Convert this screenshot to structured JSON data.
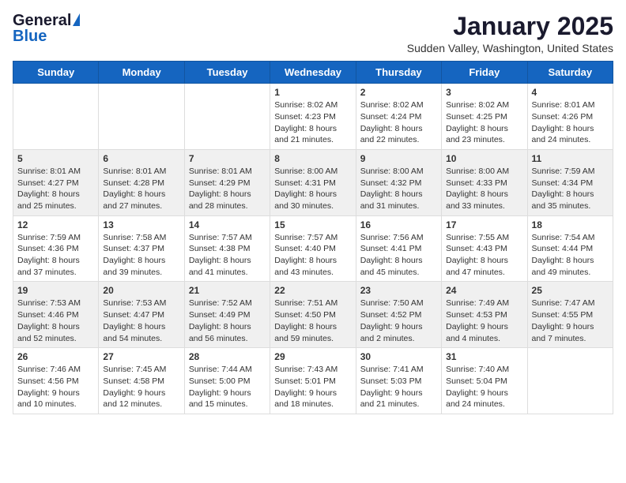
{
  "logo": {
    "general": "General",
    "blue": "Blue"
  },
  "title": "January 2025",
  "location": "Sudden Valley, Washington, United States",
  "days_of_week": [
    "Sunday",
    "Monday",
    "Tuesday",
    "Wednesday",
    "Thursday",
    "Friday",
    "Saturday"
  ],
  "weeks": [
    [
      {
        "day": "",
        "content": ""
      },
      {
        "day": "",
        "content": ""
      },
      {
        "day": "",
        "content": ""
      },
      {
        "day": "1",
        "content": "Sunrise: 8:02 AM\nSunset: 4:23 PM\nDaylight: 8 hours and 21 minutes."
      },
      {
        "day": "2",
        "content": "Sunrise: 8:02 AM\nSunset: 4:24 PM\nDaylight: 8 hours and 22 minutes."
      },
      {
        "day": "3",
        "content": "Sunrise: 8:02 AM\nSunset: 4:25 PM\nDaylight: 8 hours and 23 minutes."
      },
      {
        "day": "4",
        "content": "Sunrise: 8:01 AM\nSunset: 4:26 PM\nDaylight: 8 hours and 24 minutes."
      }
    ],
    [
      {
        "day": "5",
        "content": "Sunrise: 8:01 AM\nSunset: 4:27 PM\nDaylight: 8 hours and 25 minutes."
      },
      {
        "day": "6",
        "content": "Sunrise: 8:01 AM\nSunset: 4:28 PM\nDaylight: 8 hours and 27 minutes."
      },
      {
        "day": "7",
        "content": "Sunrise: 8:01 AM\nSunset: 4:29 PM\nDaylight: 8 hours and 28 minutes."
      },
      {
        "day": "8",
        "content": "Sunrise: 8:00 AM\nSunset: 4:31 PM\nDaylight: 8 hours and 30 minutes."
      },
      {
        "day": "9",
        "content": "Sunrise: 8:00 AM\nSunset: 4:32 PM\nDaylight: 8 hours and 31 minutes."
      },
      {
        "day": "10",
        "content": "Sunrise: 8:00 AM\nSunset: 4:33 PM\nDaylight: 8 hours and 33 minutes."
      },
      {
        "day": "11",
        "content": "Sunrise: 7:59 AM\nSunset: 4:34 PM\nDaylight: 8 hours and 35 minutes."
      }
    ],
    [
      {
        "day": "12",
        "content": "Sunrise: 7:59 AM\nSunset: 4:36 PM\nDaylight: 8 hours and 37 minutes."
      },
      {
        "day": "13",
        "content": "Sunrise: 7:58 AM\nSunset: 4:37 PM\nDaylight: 8 hours and 39 minutes."
      },
      {
        "day": "14",
        "content": "Sunrise: 7:57 AM\nSunset: 4:38 PM\nDaylight: 8 hours and 41 minutes."
      },
      {
        "day": "15",
        "content": "Sunrise: 7:57 AM\nSunset: 4:40 PM\nDaylight: 8 hours and 43 minutes."
      },
      {
        "day": "16",
        "content": "Sunrise: 7:56 AM\nSunset: 4:41 PM\nDaylight: 8 hours and 45 minutes."
      },
      {
        "day": "17",
        "content": "Sunrise: 7:55 AM\nSunset: 4:43 PM\nDaylight: 8 hours and 47 minutes."
      },
      {
        "day": "18",
        "content": "Sunrise: 7:54 AM\nSunset: 4:44 PM\nDaylight: 8 hours and 49 minutes."
      }
    ],
    [
      {
        "day": "19",
        "content": "Sunrise: 7:53 AM\nSunset: 4:46 PM\nDaylight: 8 hours and 52 minutes."
      },
      {
        "day": "20",
        "content": "Sunrise: 7:53 AM\nSunset: 4:47 PM\nDaylight: 8 hours and 54 minutes."
      },
      {
        "day": "21",
        "content": "Sunrise: 7:52 AM\nSunset: 4:49 PM\nDaylight: 8 hours and 56 minutes."
      },
      {
        "day": "22",
        "content": "Sunrise: 7:51 AM\nSunset: 4:50 PM\nDaylight: 8 hours and 59 minutes."
      },
      {
        "day": "23",
        "content": "Sunrise: 7:50 AM\nSunset: 4:52 PM\nDaylight: 9 hours and 2 minutes."
      },
      {
        "day": "24",
        "content": "Sunrise: 7:49 AM\nSunset: 4:53 PM\nDaylight: 9 hours and 4 minutes."
      },
      {
        "day": "25",
        "content": "Sunrise: 7:47 AM\nSunset: 4:55 PM\nDaylight: 9 hours and 7 minutes."
      }
    ],
    [
      {
        "day": "26",
        "content": "Sunrise: 7:46 AM\nSunset: 4:56 PM\nDaylight: 9 hours and 10 minutes."
      },
      {
        "day": "27",
        "content": "Sunrise: 7:45 AM\nSunset: 4:58 PM\nDaylight: 9 hours and 12 minutes."
      },
      {
        "day": "28",
        "content": "Sunrise: 7:44 AM\nSunset: 5:00 PM\nDaylight: 9 hours and 15 minutes."
      },
      {
        "day": "29",
        "content": "Sunrise: 7:43 AM\nSunset: 5:01 PM\nDaylight: 9 hours and 18 minutes."
      },
      {
        "day": "30",
        "content": "Sunrise: 7:41 AM\nSunset: 5:03 PM\nDaylight: 9 hours and 21 minutes."
      },
      {
        "day": "31",
        "content": "Sunrise: 7:40 AM\nSunset: 5:04 PM\nDaylight: 9 hours and 24 minutes."
      },
      {
        "day": "",
        "content": ""
      }
    ]
  ]
}
